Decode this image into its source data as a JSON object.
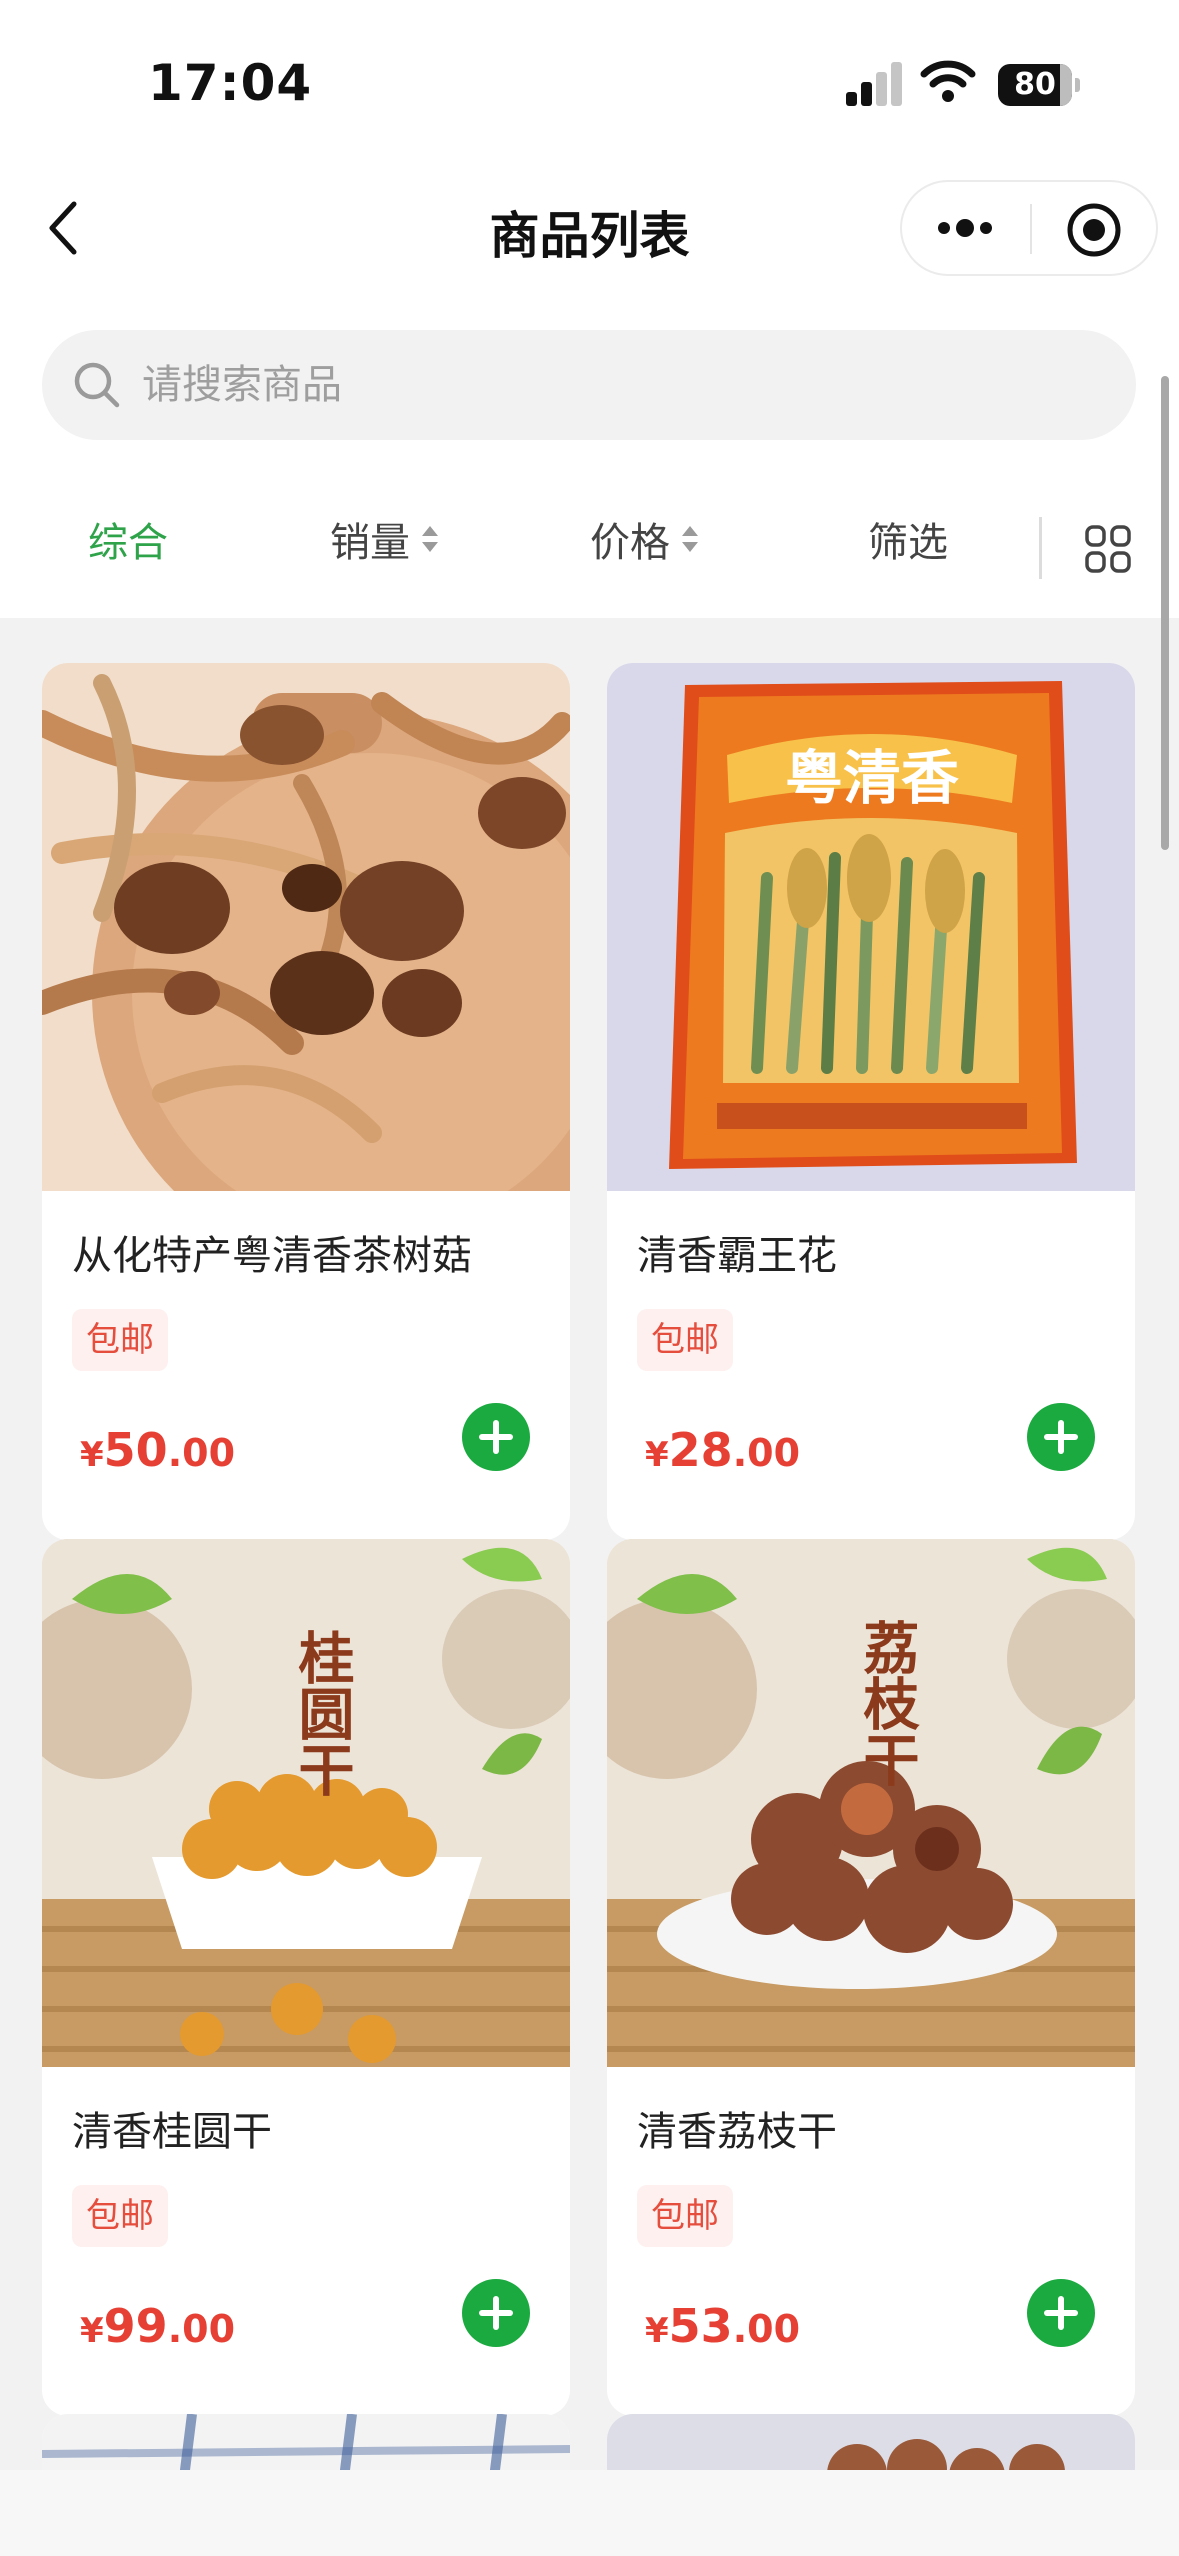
{
  "status_bar": {
    "time": "17:04",
    "battery": "80"
  },
  "nav": {
    "title": "商品列表"
  },
  "search": {
    "placeholder": "请搜索商品"
  },
  "sort_tabs": [
    {
      "label": "综合",
      "active": true
    },
    {
      "label": "销量",
      "active": false
    },
    {
      "label": "价格",
      "active": false
    },
    {
      "label": "筛选",
      "active": false
    }
  ],
  "products": [
    {
      "name": "从化特产粤清香茶树菇",
      "tag": "包邮",
      "currency": "¥",
      "price_int": "50",
      "price_dec": ".00"
    },
    {
      "name": "清香霸王花",
      "tag": "包邮",
      "currency": "¥",
      "price_int": "28",
      "price_dec": ".00"
    },
    {
      "name": "清香桂圆干",
      "tag": "包邮",
      "currency": "¥",
      "price_int": "99",
      "price_dec": ".00"
    },
    {
      "name": "清香荔枝干",
      "tag": "包邮",
      "currency": "¥",
      "price_int": "53",
      "price_dec": ".00"
    }
  ],
  "product_images": [
    {
      "brand_text": "",
      "title_text": ""
    },
    {
      "brand_text": "粤清香",
      "title_text": ""
    },
    {
      "brand_text": "",
      "title_text": "桂圆干"
    },
    {
      "brand_text": "",
      "title_text": "荔枝干"
    }
  ],
  "colors": {
    "accent": "#2fa34a",
    "price": "#e64035",
    "add_button": "#1aaa3f",
    "tag_bg": "#fdf0ef"
  }
}
